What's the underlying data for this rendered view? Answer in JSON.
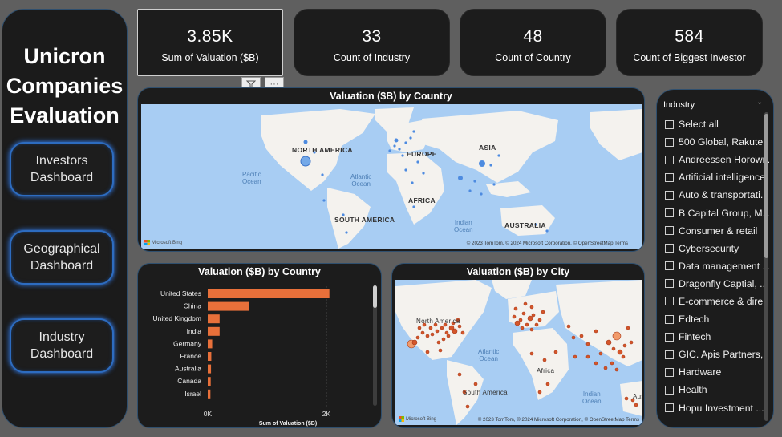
{
  "nav": {
    "title_lines": [
      "Unicron",
      "Companies",
      "Evaluation"
    ],
    "buttons": [
      {
        "line1": "Investors",
        "line2": "Dashboard"
      },
      {
        "line1": "Geographical",
        "line2": "Dashboard"
      },
      {
        "line1": "Industry",
        "line2": "Dashboard"
      }
    ]
  },
  "kpis": [
    {
      "value": "3.85K",
      "label": "Sum of Valuation ($B)"
    },
    {
      "value": "33",
      "label": "Count of Industry"
    },
    {
      "value": "48",
      "label": "Count of Country"
    },
    {
      "value": "584",
      "label": "Count of Biggest Investor"
    }
  ],
  "visual_icons": [
    "filter-icon",
    "more-options-icon"
  ],
  "map_country": {
    "title": "Valuation ($B) by Country",
    "continents": [
      "NORTH AMERICA",
      "EUROPE",
      "ASIA",
      "AFRICA",
      "SOUTH AMERICA",
      "AUSTRALIA"
    ],
    "oceans": [
      {
        "line1": "Pacific",
        "line2": "Ocean"
      },
      {
        "line1": "Atlantic",
        "line2": "Ocean"
      },
      {
        "line1": "Indian",
        "line2": "Ocean"
      }
    ],
    "provider": "Microsoft Bing",
    "copyright": "© 2023 TomTom, © 2024 Microsoft Corporation, © OpenStreetMap  Terms"
  },
  "bar_chart": {
    "title": "Valuation ($B) by Country",
    "xlabel": "Sum of Valuation ($B)",
    "bar_color": "#e8703a"
  },
  "chart_data": {
    "type": "bar",
    "orientation": "horizontal",
    "title": "Valuation ($B) by Country",
    "xlabel": "Sum of Valuation ($B)",
    "categories": [
      "United States",
      "China",
      "United Kingdom",
      "India",
      "Germany",
      "France",
      "Australia",
      "Canada",
      "Israel"
    ],
    "values": [
      2050,
      690,
      200,
      200,
      75,
      60,
      55,
      50,
      45
    ],
    "x_ticks": [
      "0K",
      "2K"
    ],
    "xlim": [
      0,
      2200
    ],
    "grid": true
  },
  "map_city": {
    "title": "Valuation ($B) by City",
    "continents": [
      "North America",
      "Africa",
      "South America"
    ],
    "oceans": [
      {
        "line1": "Atlantic",
        "line2": "Ocean"
      },
      {
        "line1": "Indian",
        "line2": "Ocean"
      }
    ],
    "asia_partial": "Aust",
    "provider": "Microsoft Bing",
    "copyright": "© 2023 TomTom, © 2024 Microsoft Corporation, © OpenStreetMap  Terms"
  },
  "slicer": {
    "header": "Industry",
    "items": [
      "Select all",
      "500 Global, Rakute...",
      "Andreessen Horowi...",
      "Artificial intelligence",
      "Auto & transportati...",
      "B Capital Group, M...",
      "Consumer & retail",
      "Cybersecurity",
      "Data management ...",
      "Dragonfly Captial, ...",
      "E-commerce & dire...",
      "Edtech",
      "Fintech",
      "GIC. Apis Partners, I...",
      "Hardware",
      "Health",
      "Hopu Investment ..."
    ]
  }
}
